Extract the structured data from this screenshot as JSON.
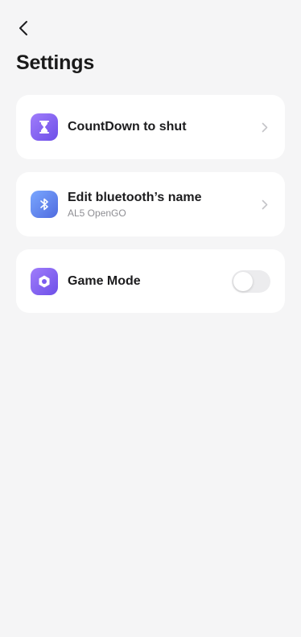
{
  "header": {
    "title": "Settings",
    "back_icon": "chevron-left-icon"
  },
  "items": [
    {
      "title": "CountDown to shut",
      "icon": "hourglass-icon",
      "accessory": "chevron-right-icon"
    },
    {
      "title": "Edit bluetooth’s name",
      "subtitle": "AL5 OpenGO",
      "icon": "bluetooth-icon",
      "accessory": "chevron-right-icon"
    },
    {
      "title": "Game Mode",
      "icon": "game-mode-icon",
      "accessory": "toggle",
      "toggle_on": false
    }
  ],
  "colors": {
    "background": "#f5f5f6",
    "card": "#ffffff",
    "accent_purple": "#7b5cf0",
    "accent_blue": "#5b7ee8",
    "toggle_off": "#ececee"
  }
}
